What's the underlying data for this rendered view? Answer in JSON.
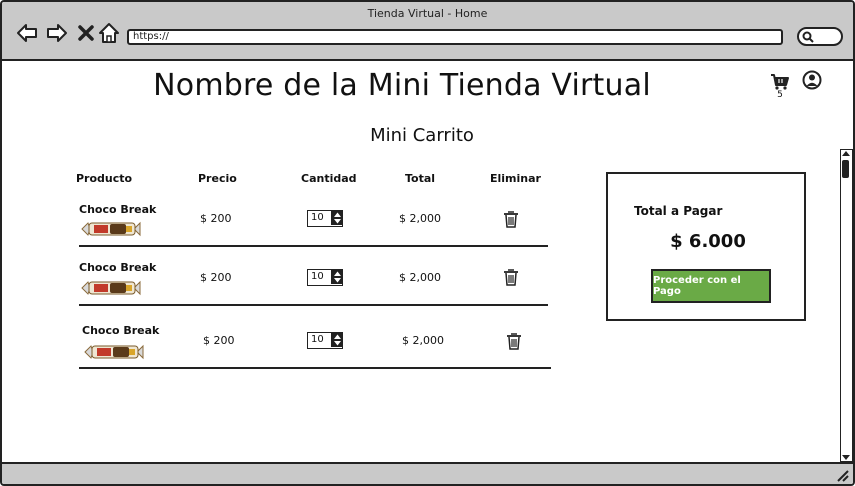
{
  "window": {
    "title": "Tienda Virtual - Home"
  },
  "browser": {
    "url": "https://",
    "icons": [
      "back-arrow-icon",
      "forward-arrow-icon",
      "close-icon",
      "home-icon",
      "search-icon"
    ]
  },
  "header": {
    "store_name": "Nombre de la Mini Tienda Virtual",
    "cart_count": "5",
    "icons": [
      "cart-icon",
      "user-icon"
    ]
  },
  "cart": {
    "title": "Mini Carrito",
    "columns": {
      "product": "Producto",
      "price": "Precio",
      "quantity": "Cantidad",
      "total": "Total",
      "remove": "Eliminar"
    },
    "items": [
      {
        "name": "Choco Break",
        "price": "$ 200",
        "quantity": "10",
        "total": "$ 2,000"
      },
      {
        "name": "Choco Break",
        "price": "$ 200",
        "quantity": "10",
        "total": "$ 2,000"
      },
      {
        "name": "Choco Break",
        "price": "$ 200",
        "quantity": "10",
        "total": "$ 2,000"
      }
    ]
  },
  "summary": {
    "label": "Total a Pagar",
    "amount": "$ 6.000",
    "pay_button": "Proceder con el Pago",
    "button_color": "#6aaa46"
  }
}
